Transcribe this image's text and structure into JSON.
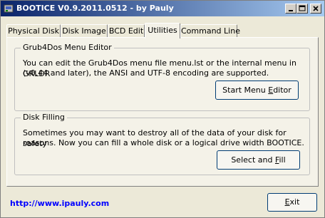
{
  "window": {
    "title": "BOOTICE V0.9.2011.0512 - by Pauly"
  },
  "tabs": [
    {
      "label": "Physical Disk",
      "active": false
    },
    {
      "label": "Disk Image",
      "active": false
    },
    {
      "label": "BCD Edit",
      "active": false
    },
    {
      "label": "Utilities",
      "active": true
    },
    {
      "label": "Command Line",
      "active": false
    }
  ],
  "grub4dos": {
    "legend": "Grub4Dos Menu Editor",
    "line1": "You can edit the Grub4Dos menu file menu.lst or the internal menu in GRLDR",
    "line2": "(v0.44 and later), the ANSI and UTF-8 encoding are supported.",
    "button_pre": "Start Menu ",
    "button_key": "E",
    "button_post": "ditor"
  },
  "disk_filling": {
    "legend": "Disk Filling",
    "line1": "Sometimes you may want to destroy all of the data of your disk for safety",
    "line2": "reasons. Now you can fill a whole disk or a logical drive width BOOTICE.",
    "button_pre": "Select and ",
    "button_key": "F",
    "button_post": "ill"
  },
  "footer": {
    "link": "http://www.ipauly.com",
    "exit_key": "E",
    "exit_post": "xit"
  }
}
